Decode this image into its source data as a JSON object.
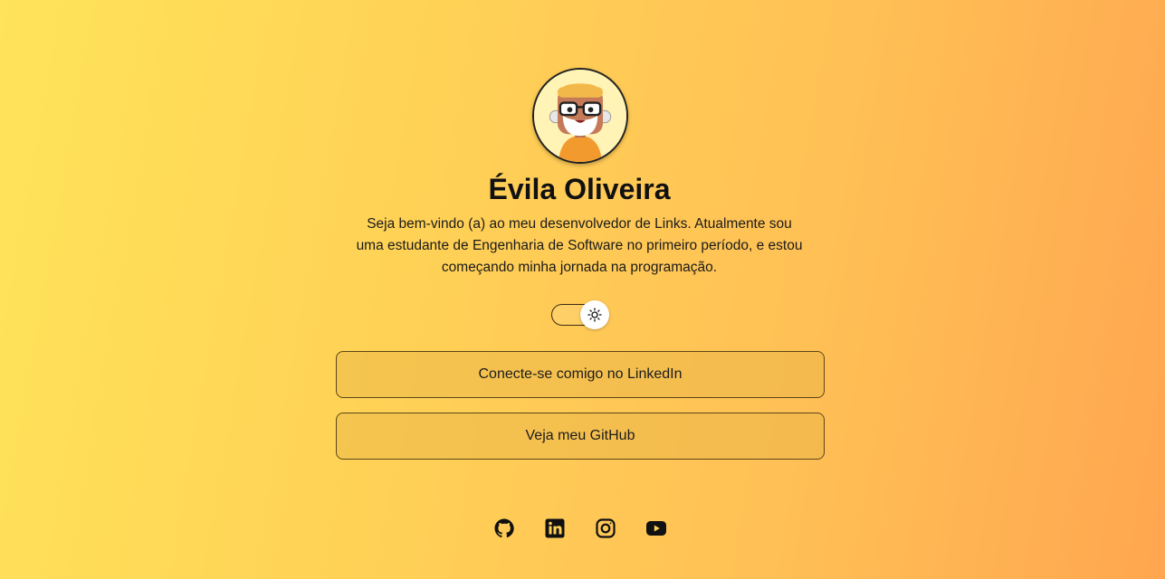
{
  "profile": {
    "avatar_icon": "cartoon-avatar-icon",
    "name": "Évila Oliveira",
    "bio": "Seja bem-vindo (a) ao meu desenvolvedor de Links. Atualmente sou uma estudante de Engenharia de Software no primeiro período, e estou começando minha jornada na programação."
  },
  "theme_toggle": {
    "icon": "sun-icon",
    "mode": "light"
  },
  "links": [
    {
      "label": "Conecte-se comigo no LinkedIn"
    },
    {
      "label": "Veja meu GitHub"
    }
  ],
  "socials": [
    {
      "icon": "github-icon"
    },
    {
      "icon": "linkedin-icon"
    },
    {
      "icon": "instagram-icon"
    },
    {
      "icon": "youtube-icon"
    }
  ],
  "colors": {
    "background_start": "#ffe35a",
    "background_end": "#ffa650",
    "text": "#111111",
    "button_border": "#5c4617"
  }
}
